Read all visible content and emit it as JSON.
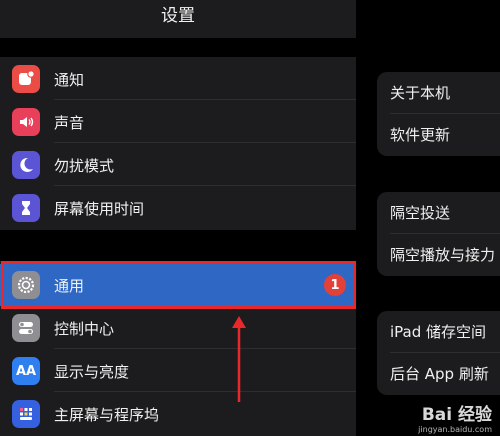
{
  "sidebar": {
    "title": "设置",
    "items": [
      {
        "label": "通知",
        "icon": "notification-icon",
        "color": "#eb4c45"
      },
      {
        "label": "声音",
        "icon": "speaker-icon",
        "color": "#e8405b"
      },
      {
        "label": "勿扰模式",
        "icon": "moon-icon",
        "color": "#5b55d6"
      },
      {
        "label": "屏幕使用时间",
        "icon": "hourglass-icon",
        "color": "#5b55d6"
      },
      {
        "label": "通用",
        "icon": "gear-icon",
        "color": "#8e8e93",
        "selected": true,
        "badge": "1"
      },
      {
        "label": "控制中心",
        "icon": "toggles-icon",
        "color": "#8e8e93"
      },
      {
        "label": "显示与亮度",
        "icon": "text-size-icon",
        "color": "#2f7ff0"
      },
      {
        "label": "主屏幕与程序坞",
        "icon": "grid-icon",
        "color": "#3560e0"
      }
    ]
  },
  "detail": {
    "groups": [
      [
        "关于本机",
        "软件更新"
      ],
      [
        "隔空投送",
        "隔空播放与接力"
      ],
      [
        "iPad 储存空间",
        "后台 App 刷新"
      ]
    ]
  },
  "watermark": {
    "logo": "Bai 经验",
    "url": "jingyan.baidu.com"
  },
  "colors": {
    "selection": "#2f67c4",
    "highlight": "#e8282b",
    "badge": "#e4403a"
  }
}
